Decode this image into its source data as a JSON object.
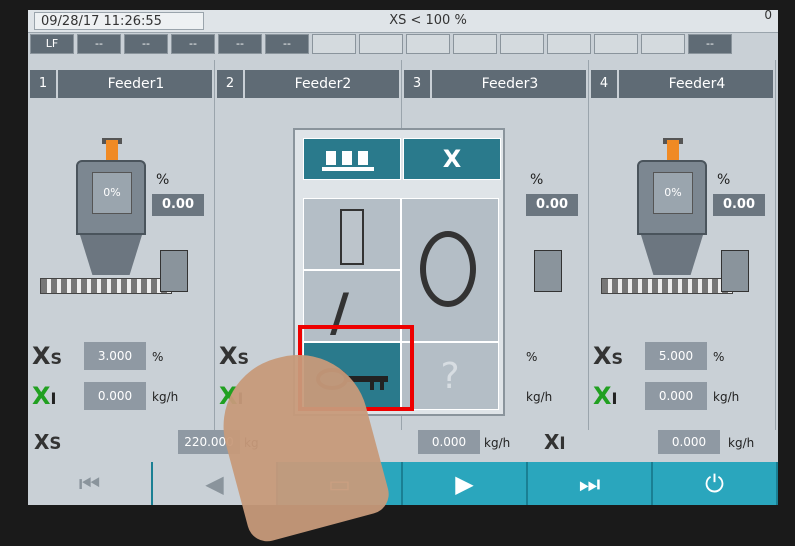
{
  "topbar": {
    "date": "09/28/17 11:26:55",
    "status": "XS < 100 %",
    "corner": "0"
  },
  "statusrow": {
    "cells": [
      "LF",
      "--",
      "--",
      "--",
      "--",
      "--",
      "",
      "",
      "",
      "",
      "",
      "",
      "",
      "",
      "--"
    ]
  },
  "feeders": [
    {
      "num": "1",
      "name": "Feeder1",
      "level": "0%",
      "value": "0.00",
      "xs_value": "3.000",
      "xs_unit": "%",
      "xi_value": "0.000",
      "xi_unit": "kg/h"
    },
    {
      "num": "2",
      "name": "Feeder2",
      "level": "",
      "value": "",
      "xs_value": "",
      "xs_unit": "",
      "xi_value": "",
      "xi_unit": ""
    },
    {
      "num": "3",
      "name": "Feeder3",
      "level": "",
      "value": "0.00",
      "xs_value": "",
      "xs_unit": "%",
      "xi_value": "",
      "xi_unit": "kg/h"
    },
    {
      "num": "4",
      "name": "Feeder4",
      "level": "0%",
      "value": "0.00",
      "xs_value": "5.000",
      "xs_unit": "%",
      "xi_value": "0.000",
      "xi_unit": "kg/h"
    }
  ],
  "total": {
    "xs_value": "220.000",
    "xs_unit": "kg",
    "mid_value": "0.000",
    "mid_unit": "kg/h",
    "xi_value": "0.000",
    "xi_unit": "kg/h"
  },
  "popup": {
    "close_label": "X",
    "help_label": "?"
  },
  "labels": {
    "xs_sub": "S",
    "xi_sub": "I",
    "pct_icon": "%"
  },
  "colors": {
    "accent": "#2aa6bd",
    "popup_blue": "#2a7a8c",
    "highlight": "#e00000"
  }
}
